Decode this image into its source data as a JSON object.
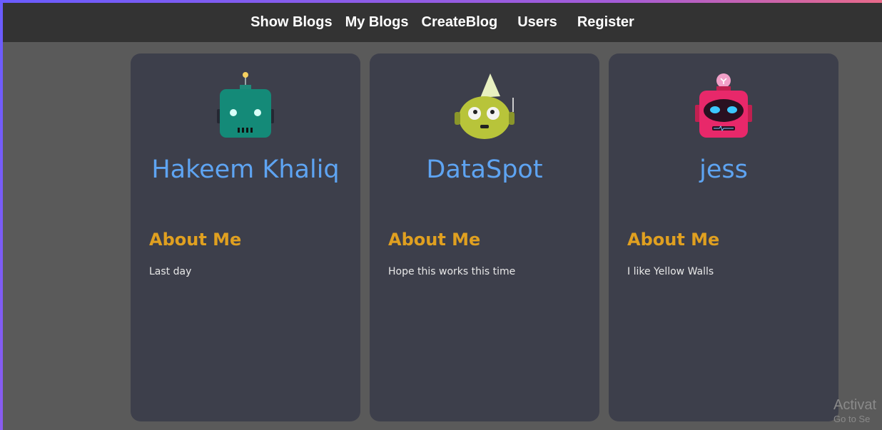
{
  "nav": {
    "links": [
      "Show Blogs",
      "My Blogs",
      "CreateBlog",
      "Users",
      "Register"
    ]
  },
  "users": [
    {
      "name": "Hakeem Khaliq",
      "avatar_icon": "teal-robot-icon",
      "about_heading": "About Me",
      "about_text": "Last day"
    },
    {
      "name": "DataSpot",
      "avatar_icon": "green-robot-icon",
      "about_heading": "About Me",
      "about_text": "Hope this works this time"
    },
    {
      "name": "jess",
      "avatar_icon": "pink-robot-icon",
      "about_heading": "About Me",
      "about_text": "I like Yellow Walls"
    }
  ],
  "watermark": {
    "line1": "Activat",
    "line2": "Go to Se"
  },
  "colors": {
    "background": "#5a5a5a",
    "navbar": "#333333",
    "card": "#3d3f4b",
    "username": "#5ea4f2",
    "heading": "#e0a020"
  }
}
